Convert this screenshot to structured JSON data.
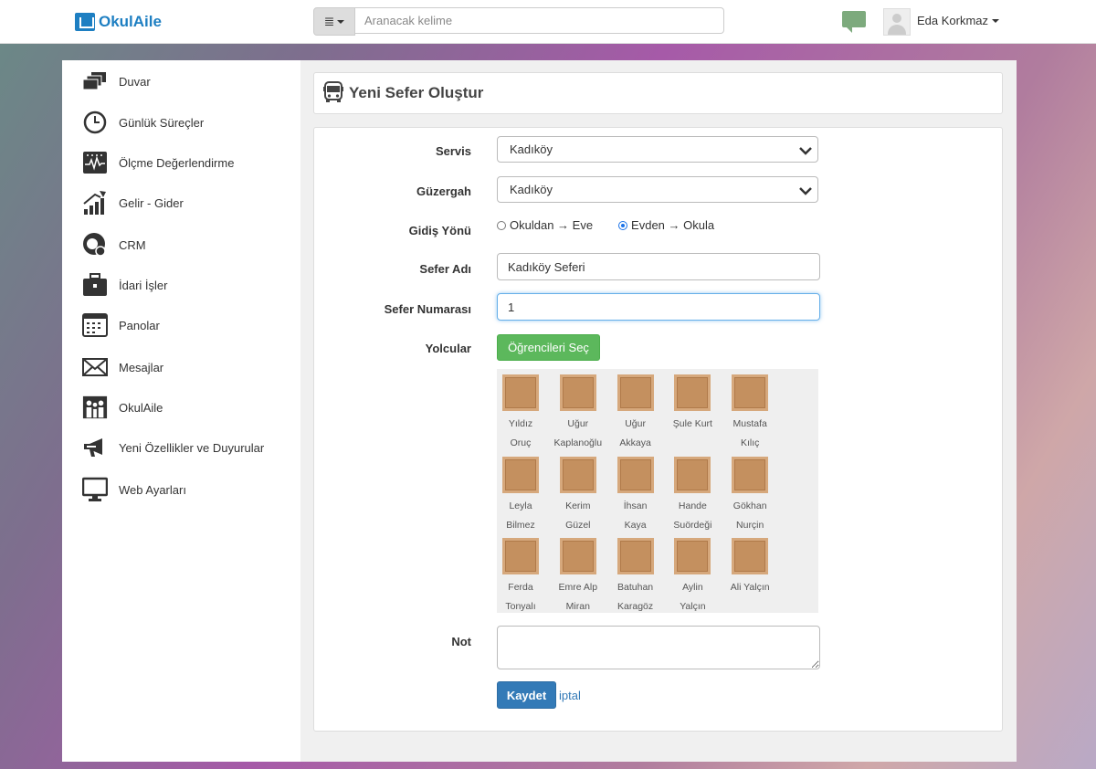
{
  "header": {
    "brand": "OkulAile",
    "search_placeholder": "Aranacak kelime",
    "user_name": "Eda Korkmaz"
  },
  "sidebar": {
    "items": [
      {
        "label": "Duvar",
        "icon": "wall-icon"
      },
      {
        "label": "Günlük Süreçler",
        "icon": "clock-icon"
      },
      {
        "label": "Ölçme Değerlendirme",
        "icon": "measure-icon"
      },
      {
        "label": "Gelir - Gider",
        "icon": "chart-icon"
      },
      {
        "label": "CRM",
        "icon": "crm-icon"
      },
      {
        "label": "İdari İşler",
        "icon": "briefcase-icon"
      },
      {
        "label": "Panolar",
        "icon": "board-icon"
      },
      {
        "label": "Mesajlar",
        "icon": "mail-icon"
      },
      {
        "label": "OkulAile",
        "icon": "family-icon"
      },
      {
        "label": "Yeni Özellikler ve Duyurular",
        "icon": "megaphone-icon"
      },
      {
        "label": "Web Ayarları",
        "icon": "monitor-icon"
      }
    ]
  },
  "page": {
    "title": "Yeni Sefer Oluştur"
  },
  "form": {
    "servis_label": "Servis",
    "servis_value": "Kadıköy",
    "guzergah_label": "Güzergah",
    "guzergah_value": "Kadıköy",
    "yon_label": "Gidiş Yönü",
    "yon_option_1": "Okuldan → Eve",
    "yon_option_2": "Evden → Okula",
    "yon_selected": "Evden → Okula",
    "sefer_adi_label": "Sefer Adı",
    "sefer_adi_value": "Kadıköy Seferi",
    "sefer_no_label": "Sefer Numarası",
    "sefer_no_value": "1",
    "yolcular_label": "Yolcular",
    "select_students_label": "Öğrencileri Seç",
    "not_label": "Not",
    "save_label": "Kaydet",
    "cancel_label": "iptal"
  },
  "students": [
    {
      "first": "Yıldız",
      "last": "Oruç"
    },
    {
      "first": "Uğur",
      "last": "Kaplanoğlu"
    },
    {
      "first": "Uğur",
      "last": "Akkaya"
    },
    {
      "first": "Şule Kurt",
      "last": ""
    },
    {
      "first": "Mustafa",
      "last": "Kılıç"
    },
    {
      "first": "Leyla",
      "last": "Bilmez"
    },
    {
      "first": "Kerim",
      "last": "Güzel"
    },
    {
      "first": "İhsan",
      "last": "Kaya"
    },
    {
      "first": "Hande",
      "last": "Suördeği"
    },
    {
      "first": "Gökhan",
      "last": "Nurçin"
    },
    {
      "first": "Ferda",
      "last": "Tonyalı"
    },
    {
      "first": "Emre Alp",
      "last": "Miran"
    },
    {
      "first": "Batuhan",
      "last": "Karagöz"
    },
    {
      "first": "Aylin",
      "last": "Yalçın"
    },
    {
      "first": "Ali Yalçın",
      "last": ""
    }
  ]
}
